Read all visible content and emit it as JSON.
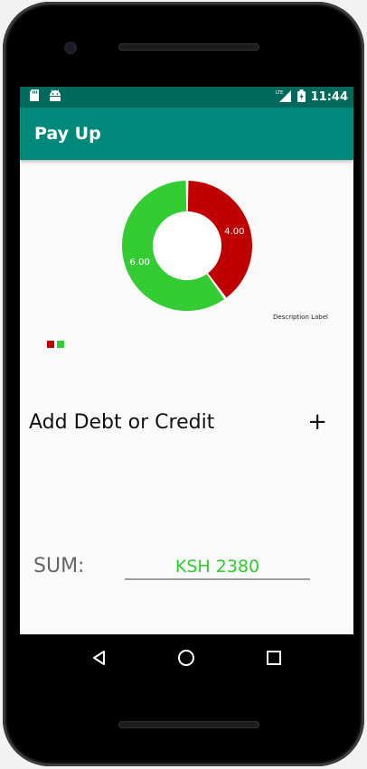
{
  "status_bar": {
    "time": "11:44",
    "network": "LTE",
    "icons": [
      "sd-card-icon",
      "android-icon",
      "signal-icon",
      "battery-icon"
    ]
  },
  "app_bar": {
    "title": "Pay Up"
  },
  "chart_data": {
    "type": "pie",
    "donut": true,
    "slices": [
      {
        "value": 4.0,
        "label": "4.00",
        "color": "#c00000"
      },
      {
        "value": 6.0,
        "label": "6.00",
        "color": "#33cc33"
      }
    ],
    "description": "Description Label",
    "legend": [
      {
        "color": "#c00000"
      },
      {
        "color": "#33cc33"
      }
    ]
  },
  "main": {
    "add_label": "Add Debt or Credit",
    "add_button": "+",
    "sum_label": "SUM:",
    "sum_value": "KSH  2380",
    "sum_color": "#2ecc2e"
  },
  "nav_bar": {
    "buttons": [
      "back-icon",
      "home-icon",
      "recents-icon"
    ]
  }
}
